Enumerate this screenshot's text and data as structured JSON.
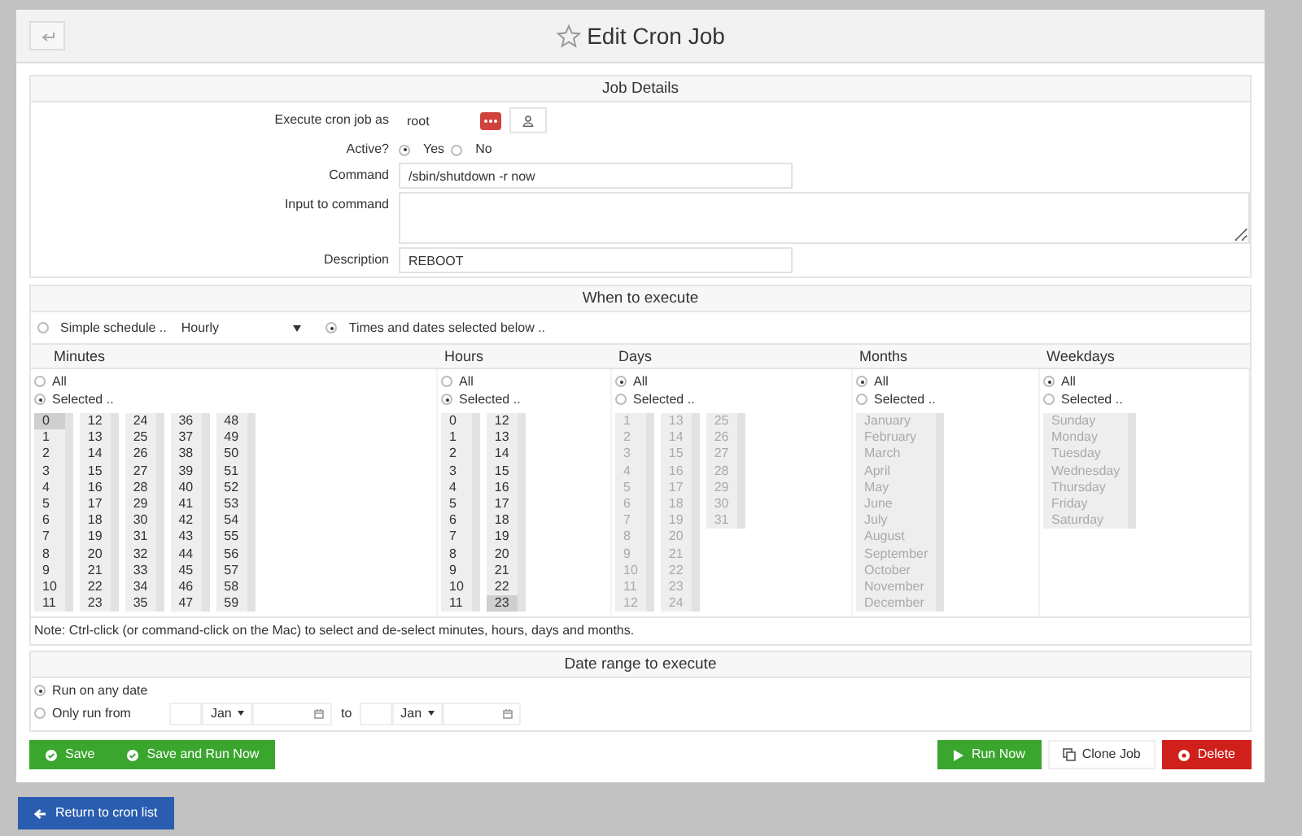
{
  "header": {
    "title": "Edit Cron Job"
  },
  "job_details": {
    "title": "Job Details",
    "user": {
      "label": "Execute cron job as",
      "value": "root"
    },
    "active": {
      "label": "Active?",
      "options": [
        {
          "label": "Yes",
          "selected": true
        },
        {
          "label": "No",
          "selected": false
        }
      ]
    },
    "command": {
      "label": "Command",
      "value": "/sbin/shutdown -r now"
    },
    "input": {
      "label": "Input to command"
    },
    "description": {
      "label": "Description",
      "value": "REBOOT"
    }
  },
  "when": {
    "title": "When to execute",
    "modes": [
      {
        "kind": "simple",
        "label": "Simple schedule ..",
        "selected": false,
        "value": "Hourly"
      },
      {
        "kind": "times",
        "label": "Times and dates selected below ..",
        "selected": true
      }
    ],
    "fields": [
      {
        "title": "Minutes",
        "disabled": false,
        "options": [
          {
            "label": "All",
            "selected": false
          },
          {
            "label": "Selected ..",
            "selected": true
          }
        ],
        "boxes": [
          [
            {
              "label": "0",
              "selected": true
            },
            {
              "label": "1",
              "selected": false
            },
            {
              "label": "2",
              "selected": false
            },
            {
              "label": "3",
              "selected": false
            },
            {
              "label": "4",
              "selected": false
            },
            {
              "label": "5",
              "selected": false
            },
            {
              "label": "6",
              "selected": false
            },
            {
              "label": "7",
              "selected": false
            },
            {
              "label": "8",
              "selected": false
            },
            {
              "label": "9",
              "selected": false
            },
            {
              "label": "10",
              "selected": false
            },
            {
              "label": "11",
              "selected": false
            }
          ],
          [
            {
              "label": "12",
              "selected": false
            },
            {
              "label": "13",
              "selected": false
            },
            {
              "label": "14",
              "selected": false
            },
            {
              "label": "15",
              "selected": false
            },
            {
              "label": "16",
              "selected": false
            },
            {
              "label": "17",
              "selected": false
            },
            {
              "label": "18",
              "selected": false
            },
            {
              "label": "19",
              "selected": false
            },
            {
              "label": "20",
              "selected": false
            },
            {
              "label": "21",
              "selected": false
            },
            {
              "label": "22",
              "selected": false
            },
            {
              "label": "23",
              "selected": false
            }
          ],
          [
            {
              "label": "24",
              "selected": false
            },
            {
              "label": "25",
              "selected": false
            },
            {
              "label": "26",
              "selected": false
            },
            {
              "label": "27",
              "selected": false
            },
            {
              "label": "28",
              "selected": false
            },
            {
              "label": "29",
              "selected": false
            },
            {
              "label": "30",
              "selected": false
            },
            {
              "label": "31",
              "selected": false
            },
            {
              "label": "32",
              "selected": false
            },
            {
              "label": "33",
              "selected": false
            },
            {
              "label": "34",
              "selected": false
            },
            {
              "label": "35",
              "selected": false
            }
          ],
          [
            {
              "label": "36",
              "selected": false
            },
            {
              "label": "37",
              "selected": false
            },
            {
              "label": "38",
              "selected": false
            },
            {
              "label": "39",
              "selected": false
            },
            {
              "label": "40",
              "selected": false
            },
            {
              "label": "41",
              "selected": false
            },
            {
              "label": "42",
              "selected": false
            },
            {
              "label": "43",
              "selected": false
            },
            {
              "label": "44",
              "selected": false
            },
            {
              "label": "45",
              "selected": false
            },
            {
              "label": "46",
              "selected": false
            },
            {
              "label": "47",
              "selected": false
            }
          ],
          [
            {
              "label": "48",
              "selected": false
            },
            {
              "label": "49",
              "selected": false
            },
            {
              "label": "50",
              "selected": false
            },
            {
              "label": "51",
              "selected": false
            },
            {
              "label": "52",
              "selected": false
            },
            {
              "label": "53",
              "selected": false
            },
            {
              "label": "54",
              "selected": false
            },
            {
              "label": "55",
              "selected": false
            },
            {
              "label": "56",
              "selected": false
            },
            {
              "label": "57",
              "selected": false
            },
            {
              "label": "58",
              "selected": false
            },
            {
              "label": "59",
              "selected": false
            }
          ]
        ]
      },
      {
        "title": "Hours",
        "disabled": false,
        "options": [
          {
            "label": "All",
            "selected": false
          },
          {
            "label": "Selected ..",
            "selected": true
          }
        ],
        "boxes": [
          [
            {
              "label": "0",
              "selected": false
            },
            {
              "label": "1",
              "selected": false
            },
            {
              "label": "2",
              "selected": false
            },
            {
              "label": "3",
              "selected": false
            },
            {
              "label": "4",
              "selected": false
            },
            {
              "label": "5",
              "selected": false
            },
            {
              "label": "6",
              "selected": false
            },
            {
              "label": "7",
              "selected": false
            },
            {
              "label": "8",
              "selected": false
            },
            {
              "label": "9",
              "selected": false
            },
            {
              "label": "10",
              "selected": false
            },
            {
              "label": "11",
              "selected": false
            }
          ],
          [
            {
              "label": "12",
              "selected": false
            },
            {
              "label": "13",
              "selected": false
            },
            {
              "label": "14",
              "selected": false
            },
            {
              "label": "15",
              "selected": false
            },
            {
              "label": "16",
              "selected": false
            },
            {
              "label": "17",
              "selected": false
            },
            {
              "label": "18",
              "selected": false
            },
            {
              "label": "19",
              "selected": false
            },
            {
              "label": "20",
              "selected": false
            },
            {
              "label": "21",
              "selected": false
            },
            {
              "label": "22",
              "selected": false
            },
            {
              "label": "23",
              "selected": true
            }
          ]
        ]
      },
      {
        "title": "Days",
        "disabled": true,
        "options": [
          {
            "label": "All",
            "selected": true
          },
          {
            "label": "Selected ..",
            "selected": false
          }
        ],
        "boxes": [
          [
            {
              "label": "1",
              "selected": false
            },
            {
              "label": "2",
              "selected": false
            },
            {
              "label": "3",
              "selected": false
            },
            {
              "label": "4",
              "selected": false
            },
            {
              "label": "5",
              "selected": false
            },
            {
              "label": "6",
              "selected": false
            },
            {
              "label": "7",
              "selected": false
            },
            {
              "label": "8",
              "selected": false
            },
            {
              "label": "9",
              "selected": false
            },
            {
              "label": "10",
              "selected": false
            },
            {
              "label": "11",
              "selected": false
            },
            {
              "label": "12",
              "selected": false
            }
          ],
          [
            {
              "label": "13",
              "selected": false
            },
            {
              "label": "14",
              "selected": false
            },
            {
              "label": "15",
              "selected": false
            },
            {
              "label": "16",
              "selected": false
            },
            {
              "label": "17",
              "selected": false
            },
            {
              "label": "18",
              "selected": false
            },
            {
              "label": "19",
              "selected": false
            },
            {
              "label": "20",
              "selected": false
            },
            {
              "label": "21",
              "selected": false
            },
            {
              "label": "22",
              "selected": false
            },
            {
              "label": "23",
              "selected": false
            },
            {
              "label": "24",
              "selected": false
            }
          ],
          [
            {
              "label": "25",
              "selected": false
            },
            {
              "label": "26",
              "selected": false
            },
            {
              "label": "27",
              "selected": false
            },
            {
              "label": "28",
              "selected": false
            },
            {
              "label": "29",
              "selected": false
            },
            {
              "label": "30",
              "selected": false
            },
            {
              "label": "31",
              "selected": false
            }
          ]
        ]
      },
      {
        "title": "Months",
        "disabled": true,
        "options": [
          {
            "label": "All",
            "selected": true
          },
          {
            "label": "Selected ..",
            "selected": false
          }
        ],
        "boxes": [
          [
            {
              "label": "January",
              "selected": false
            },
            {
              "label": "February",
              "selected": false
            },
            {
              "label": "March",
              "selected": false
            },
            {
              "label": "April",
              "selected": false
            },
            {
              "label": "May",
              "selected": false
            },
            {
              "label": "June",
              "selected": false
            },
            {
              "label": "July",
              "selected": false
            },
            {
              "label": "August",
              "selected": false
            },
            {
              "label": "September",
              "selected": false
            },
            {
              "label": "October",
              "selected": false
            },
            {
              "label": "November",
              "selected": false
            },
            {
              "label": "December",
              "selected": false
            }
          ]
        ]
      },
      {
        "title": "Weekdays",
        "disabled": true,
        "options": [
          {
            "label": "All",
            "selected": true
          },
          {
            "label": "Selected ..",
            "selected": false
          }
        ],
        "boxes": [
          [
            {
              "label": "Sunday",
              "selected": false
            },
            {
              "label": "Monday",
              "selected": false
            },
            {
              "label": "Tuesday",
              "selected": false
            },
            {
              "label": "Wednesday",
              "selected": false
            },
            {
              "label": "Thursday",
              "selected": false
            },
            {
              "label": "Friday",
              "selected": false
            },
            {
              "label": "Saturday",
              "selected": false
            }
          ]
        ]
      }
    ],
    "note": "Note: Ctrl-click (or command-click on the Mac) to select and de-select minutes, hours, days and months."
  },
  "date_range": {
    "title": "Date range to execute",
    "modes": [
      {
        "label": "Run on any date",
        "selected": true
      },
      {
        "label": "Only run from",
        "selected": false
      }
    ],
    "from": {
      "month": "Jan"
    },
    "separator": "to",
    "until": {
      "month": "Jan"
    }
  },
  "buttons": [
    {
      "kind": "save",
      "label": "Save"
    },
    {
      "kind": "save",
      "label": "Save and Run Now"
    },
    {
      "kind": "run",
      "label": "Run Now"
    },
    {
      "kind": "clone",
      "label": "Clone Job"
    },
    {
      "kind": "delete",
      "label": "Delete"
    }
  ],
  "return_button": {
    "label": "Return to cron list"
  }
}
